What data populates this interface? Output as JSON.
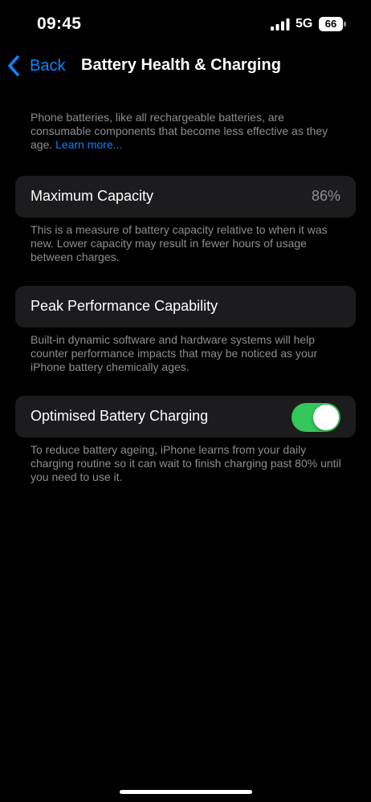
{
  "status_bar": {
    "time": "09:45",
    "network": "5G",
    "battery": "66",
    "signal_icon": "cellular-signal-icon",
    "battery_icon": "battery-icon"
  },
  "nav": {
    "back_label": "Back",
    "back_icon": "chevron-left-icon",
    "title": "Battery Health & Charging"
  },
  "intro": {
    "text": "Phone batteries, like all rechargeable batteries, are consumable components that become less effective as they age. ",
    "link": "Learn more..."
  },
  "maximum_capacity": {
    "label": "Maximum Capacity",
    "value": "86%",
    "footnote": "This is a measure of battery capacity relative to when it was new. Lower capacity may result in fewer hours of usage between charges."
  },
  "peak_performance": {
    "label": "Peak Performance Capability",
    "footnote": "Built-in dynamic software and hardware systems will help counter performance impacts that may be noticed as your iPhone battery chemically ages."
  },
  "optimised_charging": {
    "label": "Optimised Battery Charging",
    "enabled": true,
    "footnote": "To reduce battery ageing, iPhone learns from your daily charging routine so it can wait to finish charging past 80% until you need to use it."
  },
  "colors": {
    "background": "#000000",
    "cell": "#1c1c1e",
    "accent": "#0a84ff",
    "toggle_on": "#34c759",
    "secondary_text": "#8e8e93"
  }
}
